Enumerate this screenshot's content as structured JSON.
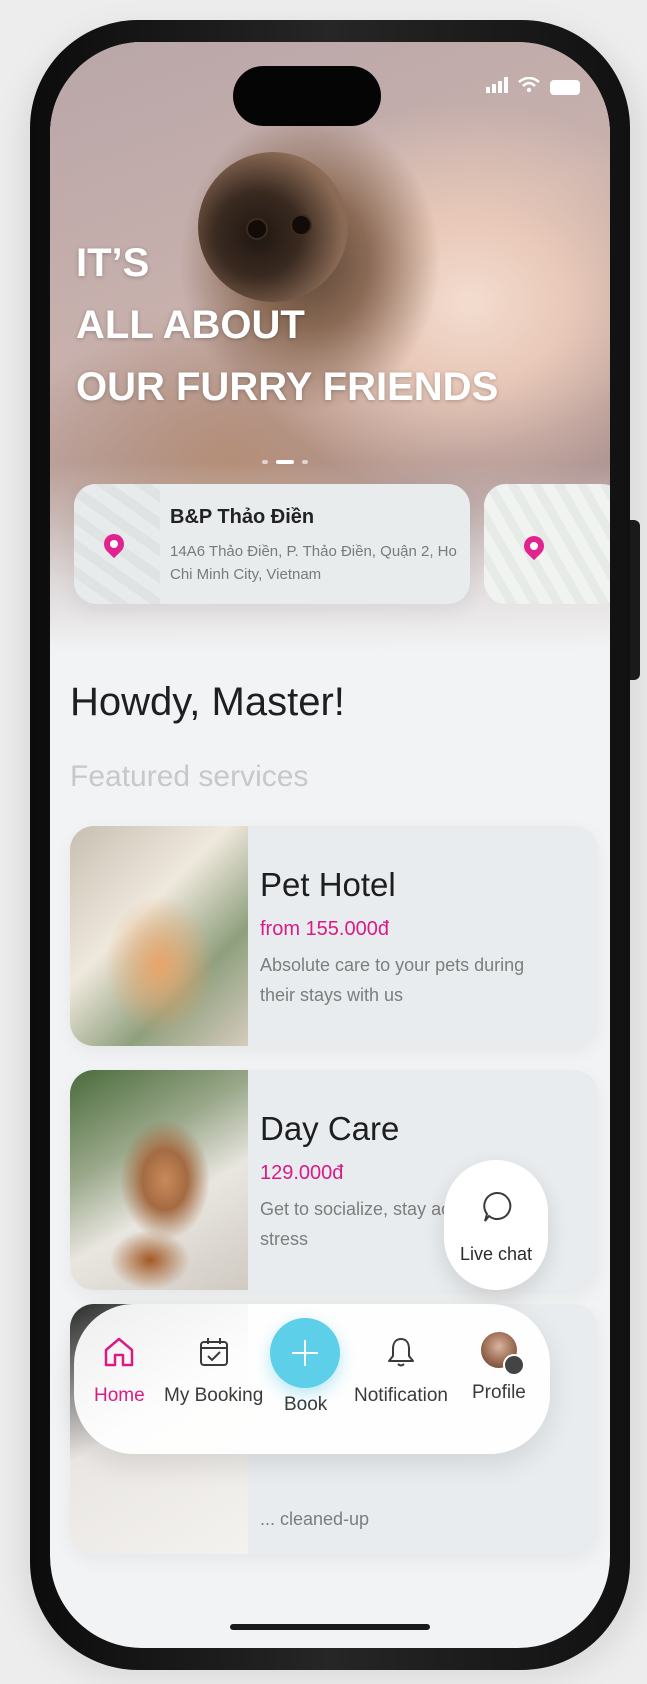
{
  "status_bar": {
    "signal_icon": "signal-bars-icon",
    "wifi_icon": "wifi-icon",
    "battery_icon": "battery-icon"
  },
  "hero": {
    "line1": "IT’S",
    "line2": "ALL ABOUT",
    "line3": "OUR FURRY FRIENDS",
    "slide_count": 3,
    "active_slide": 2
  },
  "location": {
    "name": "B&P Thảo Điền",
    "address": "14A6 Thảo Điền, P. Thảo Điền, Quận 2, Ho Chi Minh City, Vietnam"
  },
  "greeting": "Howdy, Master!",
  "featured_label": "Featured services",
  "services": [
    {
      "title": "Pet Hotel",
      "price": "from 155.000đ",
      "description": "Absolute care to your pets during their stays with us"
    },
    {
      "title": "Day Care",
      "price": "129.000đ",
      "description": "Get to socialize, stay ac realease stress"
    },
    {
      "title": "",
      "price": "",
      "description": "... cleaned-up"
    }
  ],
  "chat": {
    "label": "Live chat"
  },
  "nav": {
    "items": [
      {
        "label": "Home",
        "icon": "home-icon"
      },
      {
        "label": "My Booking",
        "icon": "calendar-icon"
      },
      {
        "label": "Book",
        "icon": "plus-icon"
      },
      {
        "label": "Notification",
        "icon": "bell-icon"
      },
      {
        "label": "Profile",
        "icon": "avatar"
      }
    ],
    "active": "Home"
  },
  "colors": {
    "accent": "#d81b86",
    "book_button": "#5ecfe8",
    "background": "#f1f3f4"
  }
}
